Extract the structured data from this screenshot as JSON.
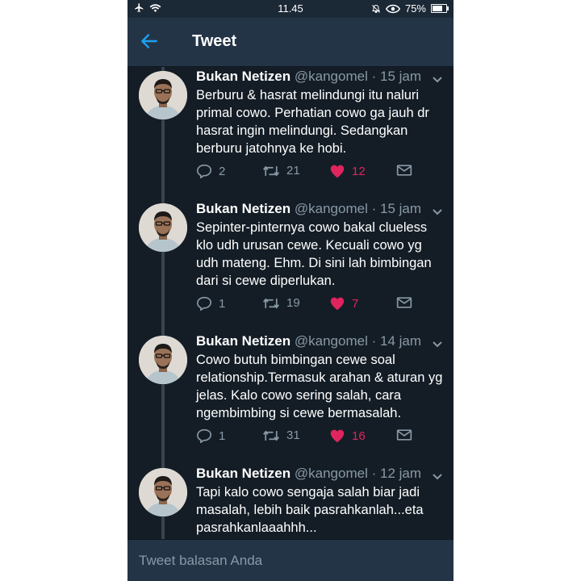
{
  "status_bar": {
    "time": "11.45",
    "battery": "75%",
    "battery_level": 0.75
  },
  "header": {
    "title": "Tweet"
  },
  "reply_bar": {
    "placeholder": "Tweet balasan Anda"
  },
  "colors": {
    "background": "#141d26",
    "header": "#243447",
    "accent": "#1da1f2",
    "like": "#e0245e",
    "muted": "#8899a6"
  },
  "tweets": [
    {
      "name": "Bukan Netizen",
      "handle": "@kangomel",
      "separator": "·",
      "time": "15 jam",
      "text": "Berburu & hasrat melindungi itu naluri primal cowo. Perhatian cowo ga jauh dr hasrat ingin melindungi. Sedangkan berburu jatohnya ke hobi.",
      "replies": "2",
      "retweets": "21",
      "likes": "12"
    },
    {
      "name": "Bukan Netizen",
      "handle": "@kangomel",
      "separator": "·",
      "time": "15 jam",
      "text": "Sepinter-pinternya cowo bakal clueless klo udh urusan cewe. Kecuali cowo yg udh mateng. Ehm. Di sini lah bimbingan dari si cewe diperlukan.",
      "replies": "1",
      "retweets": "19",
      "likes": "7"
    },
    {
      "name": "Bukan Netizen",
      "handle": "@kangomel",
      "separator": "·",
      "time": "14 jam",
      "text": "Cowo butuh bimbingan cewe soal relationship.Termasuk arahan & aturan yg jelas. Kalo cowo sering salah, cara ngembimbing si cewe bermasalah.",
      "replies": "1",
      "retweets": "31",
      "likes": "16"
    },
    {
      "name": "Bukan Netizen",
      "handle": "@kangomel",
      "separator": "·",
      "time": "12 jam",
      "text": "Tapi kalo cowo sengaja salah biar jadi masalah, lebih baik pasrahkanlah...eta pasrahkanlaaahhh...",
      "replies": "",
      "retweets": "",
      "likes": ""
    }
  ]
}
